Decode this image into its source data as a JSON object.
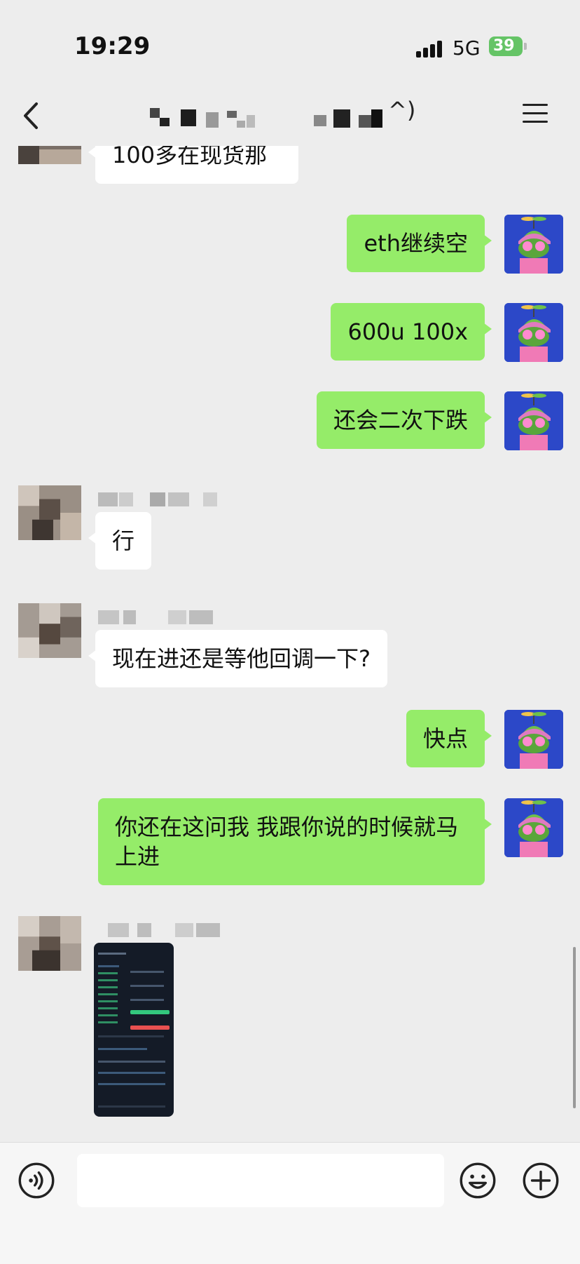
{
  "status": {
    "time": "19:29",
    "network": "5G",
    "battery": "39"
  },
  "header": {
    "title_suffix": "^)"
  },
  "messages": [
    {
      "id": "m1",
      "side": "in",
      "text": "100多在现货那"
    },
    {
      "id": "m2",
      "side": "out",
      "text": "eth继续空"
    },
    {
      "id": "m3",
      "side": "out",
      "text": "600u 100x"
    },
    {
      "id": "m4",
      "side": "out",
      "text": "还会二次下跌"
    },
    {
      "id": "m5",
      "side": "in",
      "text": "行"
    },
    {
      "id": "m6",
      "side": "in",
      "text": "现在进还是等他回调一下?"
    },
    {
      "id": "m7",
      "side": "out",
      "text": "快点"
    },
    {
      "id": "m8",
      "side": "out",
      "text": "你还在这问我 我跟你说的时候就马上进"
    },
    {
      "id": "m9",
      "side": "in",
      "type": "image"
    }
  ],
  "input": {
    "placeholder": ""
  },
  "icons": {
    "back": "chevron-left-icon",
    "menu": "menu-icon",
    "voice": "voice-icon",
    "emoji": "emoji-icon",
    "plus": "plus-icon"
  }
}
